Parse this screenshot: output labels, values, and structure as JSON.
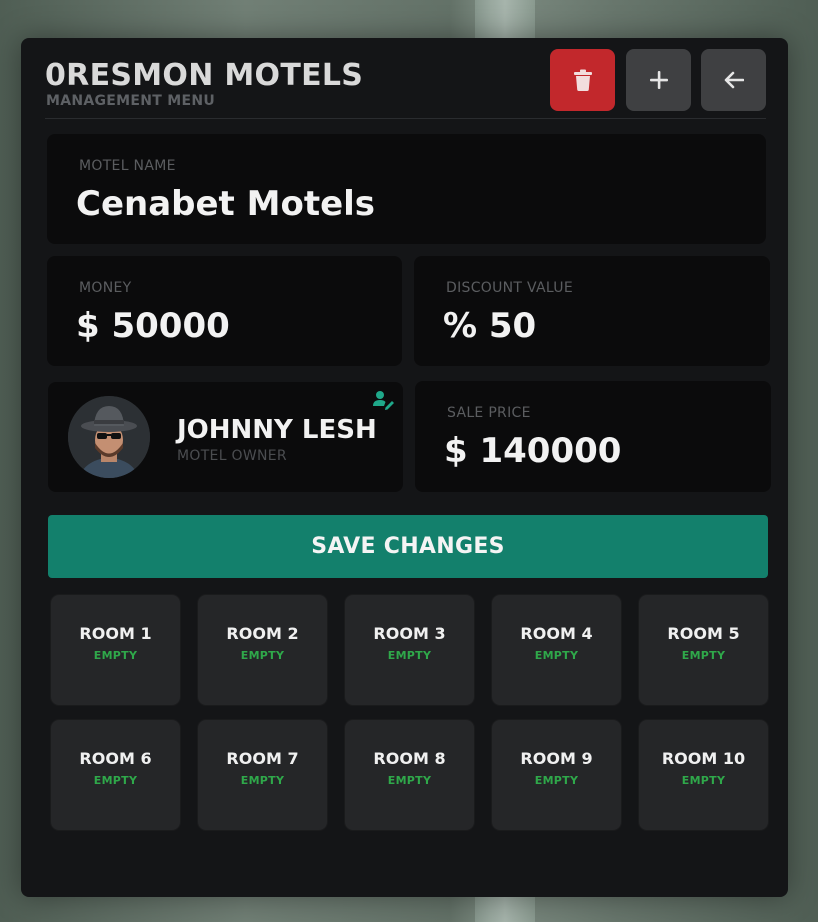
{
  "header": {
    "title": "0RESMON MOTELS",
    "subtitle": "MANAGEMENT MENU",
    "buttons": [
      {
        "name": "delete",
        "icon": "trash-icon",
        "color": "#c2282c"
      },
      {
        "name": "add",
        "icon": "plus-icon",
        "color": "#3f4042"
      },
      {
        "name": "back",
        "icon": "arrow-left-icon",
        "color": "#3f4042"
      }
    ]
  },
  "motel": {
    "name_label": "MOTEL NAME",
    "name": "Cenabet Motels",
    "money_label": "MONEY",
    "money": "$ 50000",
    "discount_label": "DISCOUNT VALUE",
    "discount": "% 50",
    "sale_label": "SALE PRICE",
    "sale_price": "$ 140000"
  },
  "owner": {
    "name": "JOHNNY LESH",
    "role": "MOTEL OWNER",
    "edit_icon": "user-edit-icon",
    "avatar_icon": "avatar"
  },
  "actions": {
    "save_label": "SAVE CHANGES",
    "save_color": "#13806c"
  },
  "rooms": [
    {
      "name": "ROOM 1",
      "status": "EMPTY"
    },
    {
      "name": "ROOM 2",
      "status": "EMPTY"
    },
    {
      "name": "ROOM 3",
      "status": "EMPTY"
    },
    {
      "name": "ROOM 4",
      "status": "EMPTY"
    },
    {
      "name": "ROOM 5",
      "status": "EMPTY"
    },
    {
      "name": "ROOM 6",
      "status": "EMPTY"
    },
    {
      "name": "ROOM 7",
      "status": "EMPTY"
    },
    {
      "name": "ROOM 8",
      "status": "EMPTY"
    },
    {
      "name": "ROOM 9",
      "status": "EMPTY"
    },
    {
      "name": "ROOM 10",
      "status": "EMPTY"
    }
  ],
  "colors": {
    "status_empty": "#2fa84a",
    "panel": "#141517",
    "card": "#0b0b0c"
  }
}
